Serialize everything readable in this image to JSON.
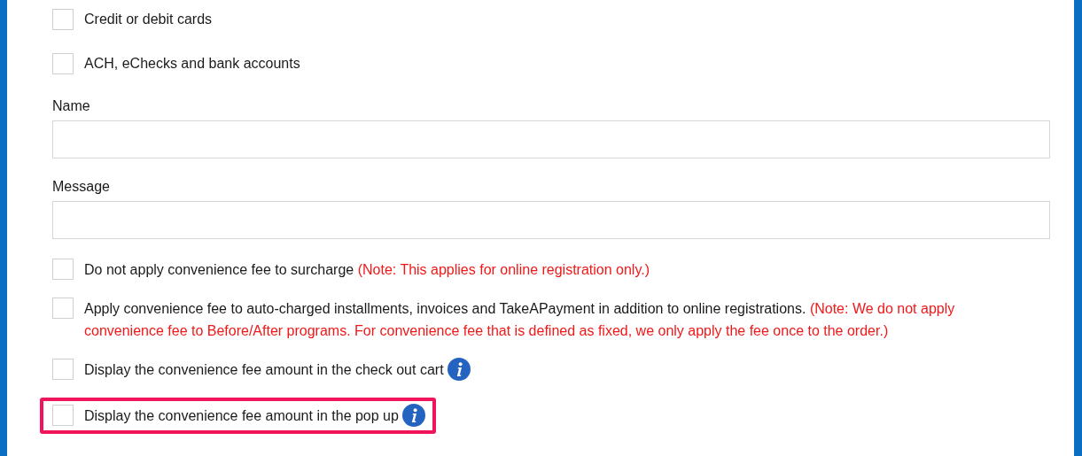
{
  "payment_types": [
    {
      "label": "Credit or debit cards",
      "checked": false
    },
    {
      "label": "ACH, eChecks and bank accounts",
      "checked": false
    }
  ],
  "fields": [
    {
      "label": "Name"
    },
    {
      "label": "Message"
    }
  ],
  "options": [
    {
      "label": "Do not apply convenience fee to surcharge",
      "note": "(Note: This applies for online registration only.)",
      "checked": false,
      "info": false,
      "highlighted": false
    },
    {
      "label": "Apply convenience fee to auto-charged installments, invoices and TakeAPayment in addition to online registrations.",
      "note": "(Note: We do not apply convenience fee to Before/After programs. For convenience fee that is defined as fixed, we only apply the fee once to the order.)",
      "checked": false,
      "info": false,
      "highlighted": false
    },
    {
      "label": "Display the convenience fee amount in the check out cart",
      "checked": false,
      "info": true,
      "highlighted": false
    },
    {
      "label": "Display the convenience fee amount in the pop up",
      "checked": false,
      "info": true,
      "highlighted": true
    }
  ]
}
